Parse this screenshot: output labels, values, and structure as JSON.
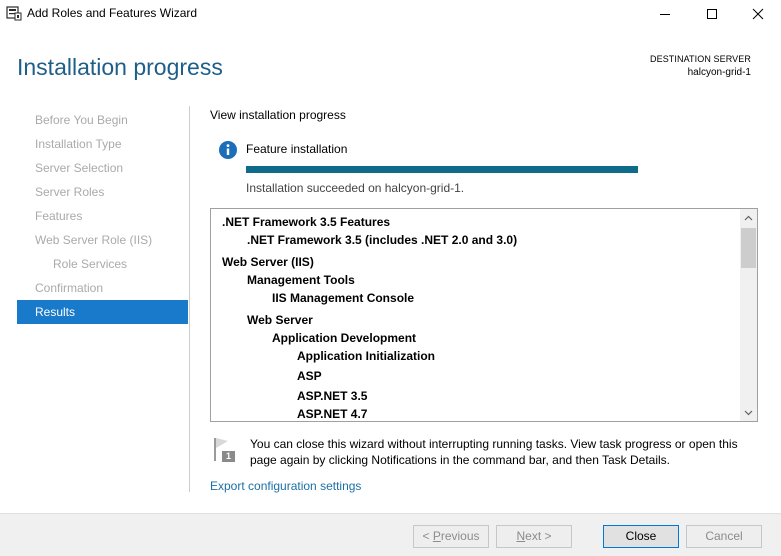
{
  "window": {
    "title": "Add Roles and Features Wizard",
    "icons": {
      "app": "server-manager-icon",
      "minimize": "minimize-icon",
      "maximize": "maximize-icon",
      "close": "close-icon"
    }
  },
  "header": {
    "page_title": "Installation progress",
    "destination_label": "DESTINATION SERVER",
    "destination_value": "halcyon-grid-1"
  },
  "nav": {
    "items": [
      {
        "label": "Before You Begin",
        "state": "disabled"
      },
      {
        "label": "Installation Type",
        "state": "disabled"
      },
      {
        "label": "Server Selection",
        "state": "disabled"
      },
      {
        "label": "Server Roles",
        "state": "disabled"
      },
      {
        "label": "Features",
        "state": "disabled"
      },
      {
        "label": "Web Server Role (IIS)",
        "state": "disabled"
      },
      {
        "label": "Role Services",
        "state": "disabled",
        "sub": true
      },
      {
        "label": "Confirmation",
        "state": "disabled"
      },
      {
        "label": "Results",
        "state": "active"
      }
    ]
  },
  "main": {
    "heading": "View installation progress",
    "feature_label": "Feature installation",
    "progress_fraction": 1.0,
    "status": "Installation succeeded on halcyon-grid-1.",
    "results": [
      {
        "text": ".NET Framework 3.5 Features",
        "level": 0
      },
      {
        "text": ".NET Framework 3.5 (includes .NET 2.0 and 3.0)",
        "level": 1
      },
      {
        "text": "Web Server (IIS)",
        "level": 0
      },
      {
        "text": "Management Tools",
        "level": 1
      },
      {
        "text": "IIS Management Console",
        "level": 2
      },
      {
        "text": "Web Server",
        "level": 1
      },
      {
        "text": "Application Development",
        "level": 2
      },
      {
        "text": "Application Initialization",
        "level": 3
      },
      {
        "text": "ASP",
        "level": 3
      },
      {
        "text": "ASP.NET 3.5",
        "level": 3
      },
      {
        "text": "ASP.NET 4.7",
        "level": 3
      }
    ],
    "notice_badge": "1",
    "notice": "You can close this wizard without interrupting running tasks. View task progress or open this page again by clicking Notifications in the command bar, and then Task Details.",
    "export_link": "Export configuration settings"
  },
  "footer": {
    "previous": {
      "prefix": "< ",
      "accel": "P",
      "rest": "revious"
    },
    "next": {
      "accel": "N",
      "rest": "ext",
      "suffix": " >"
    },
    "close": "Close",
    "cancel": "Cancel"
  },
  "colors": {
    "title_blue": "#1e5f8a",
    "nav_active": "#1979ca",
    "progress": "#0e6b8a",
    "link": "#1c6ea8"
  }
}
